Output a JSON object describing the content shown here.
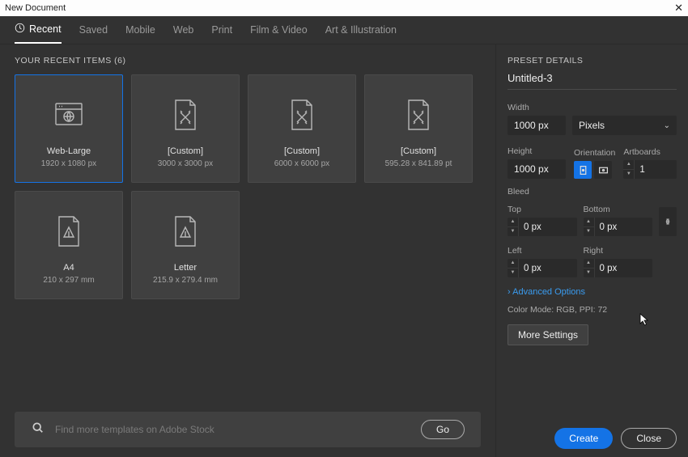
{
  "titlebar": {
    "title": "New Document"
  },
  "tabs": [
    "Recent",
    "Saved",
    "Mobile",
    "Web",
    "Print",
    "Film & Video",
    "Art & Illustration"
  ],
  "recent_label": "YOUR RECENT ITEMS  (6)",
  "cards": [
    {
      "title": "Web-Large",
      "sub": "1920 x 1080 px",
      "icon": "web"
    },
    {
      "title": "[Custom]",
      "sub": "3000 x 3000 px",
      "icon": "custom"
    },
    {
      "title": "[Custom]",
      "sub": "6000 x 6000 px",
      "icon": "custom"
    },
    {
      "title": "[Custom]",
      "sub": "595.28 x 841.89 pt",
      "icon": "custom"
    },
    {
      "title": "A4",
      "sub": "210 x 297 mm",
      "icon": "print"
    },
    {
      "title": "Letter",
      "sub": "215.9 x 279.4 mm",
      "icon": "print"
    }
  ],
  "search": {
    "placeholder": "Find more templates on Adobe Stock",
    "go": "Go"
  },
  "details": {
    "header": "PRESET DETAILS",
    "name": "Untitled-3",
    "labels": {
      "width": "Width",
      "height": "Height",
      "orientation": "Orientation",
      "artboards": "Artboards",
      "bleed": "Bleed",
      "top": "Top",
      "bottom": "Bottom",
      "left": "Left",
      "right": "Right"
    },
    "width": "1000 px",
    "height": "1000 px",
    "units": "Pixels",
    "artboards": "1",
    "bleed": {
      "top": "0 px",
      "bottom": "0 px",
      "left": "0 px",
      "right": "0 px"
    },
    "advanced": "Advanced Options",
    "colormode": "Color Mode:  RGB,  PPI: 72",
    "more": "More Settings"
  },
  "footer": {
    "create": "Create",
    "close": "Close"
  }
}
